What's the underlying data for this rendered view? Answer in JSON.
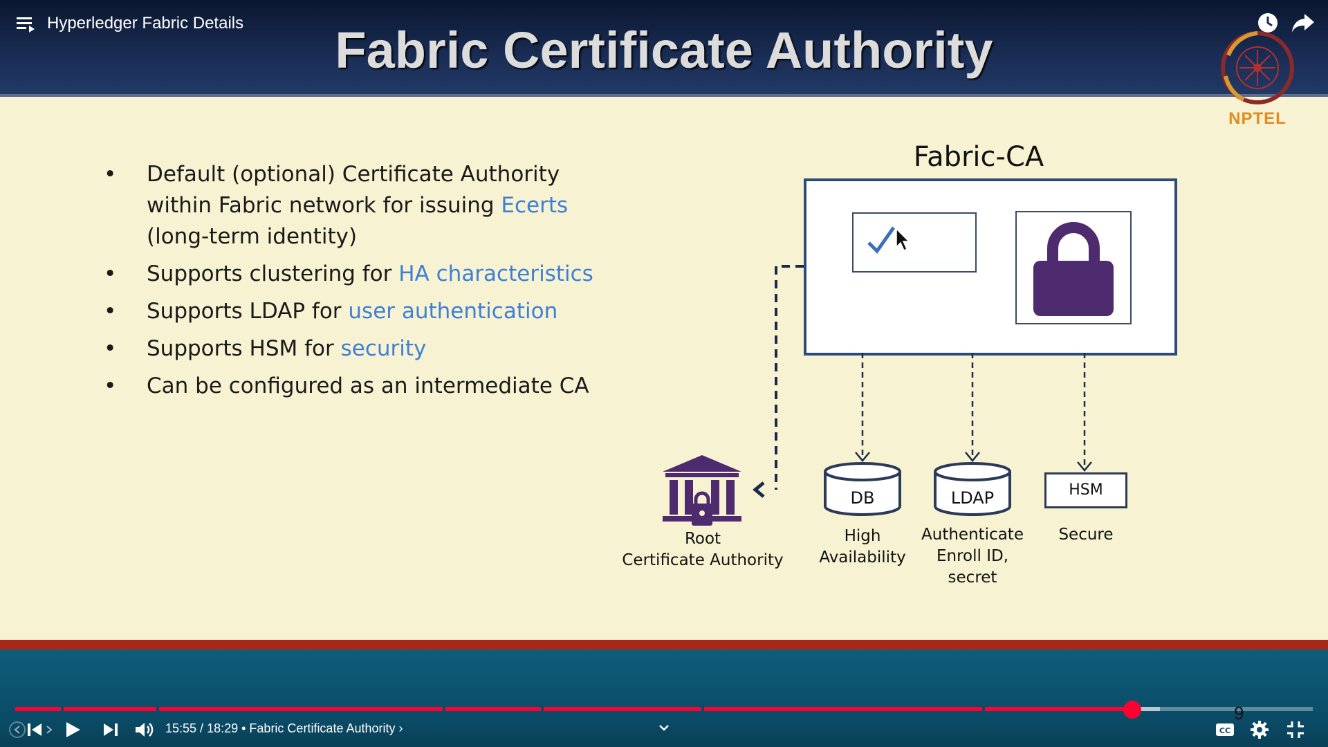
{
  "player": {
    "video_title": "Hyperledger Fabric Details",
    "time_current": "15:55",
    "time_total": "18:29",
    "chapter": "Fabric Certificate Authority",
    "chapter_marker": "9",
    "progress_fraction": 0.861,
    "buffer_fraction": 0.882,
    "accent_color": "#ff0033",
    "icons": {
      "menu": "playlist-menu-icon",
      "clock": "watch-later-icon",
      "share": "share-icon",
      "prev": "previous-icon",
      "play": "play-icon",
      "next": "next-icon",
      "volume": "volume-icon",
      "chevron": "chevron-down-icon",
      "cc": "captions-icon",
      "settings": "settings-gear-icon",
      "exit_fullscreen": "exit-fullscreen-icon"
    }
  },
  "slide": {
    "title": "Fabric Certificate Authority",
    "logo_text": "NPTEL",
    "bullets": [
      {
        "pre": "Default (optional) Certificate Authority within Fabric network for issuing ",
        "hl": "Ecerts",
        "post": " (long-term identity)"
      },
      {
        "pre": "Supports clustering for ",
        "hl": "HA characteristics",
        "post": ""
      },
      {
        "pre": "Supports LDAP for ",
        "hl": "user authentication",
        "post": ""
      },
      {
        "pre": "Supports HSM for ",
        "hl": "security",
        "post": ""
      },
      {
        "pre": "Can be configured as an intermediate CA",
        "hl": "",
        "post": ""
      }
    ],
    "highlight_color": "#3d7fd6",
    "diagram": {
      "title": "Fabric-CA",
      "root_ca": [
        "Root",
        "Certificate Authority"
      ],
      "db_label": "DB",
      "db_caption": [
        "High",
        "Availability"
      ],
      "ldap_label": "LDAP",
      "ldap_caption": [
        "Authenticate",
        "Enroll ID,",
        "secret"
      ],
      "hsm_label": "HSM",
      "hsm_caption": "Secure",
      "lock_color": "#4e2a6e"
    }
  }
}
